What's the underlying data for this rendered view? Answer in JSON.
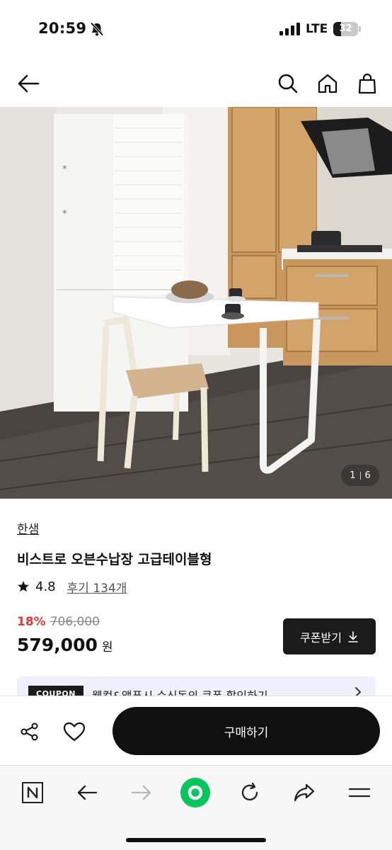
{
  "status_bar": {
    "time": "20:59",
    "network": "LTE",
    "battery_level": "32",
    "battery_fraction": 0.32,
    "icons": [
      "bell-slash-icon",
      "signal-bars-icon",
      "battery-icon"
    ]
  },
  "header": {
    "icons": [
      "back-arrow-icon",
      "search-icon",
      "home-icon",
      "shopping-bag-icon"
    ]
  },
  "gallery": {
    "current": "1",
    "total": "6"
  },
  "product": {
    "brand": "한샘",
    "title": "비스트로 오븐수납장 고급테이블형",
    "rating": "4.8",
    "review_label": "후기 134개",
    "discount": "18%",
    "original_price": "706,000",
    "price": "579,000",
    "currency": "원"
  },
  "coupon": {
    "button_label": "쿠폰받기",
    "banner_tag": "COUPON",
    "banner_text": "웰컴&앱푸시 수신동의 쿠폰 할인하기"
  },
  "action_bar": {
    "buy_label": "구매하기",
    "icons": [
      "share-icon",
      "heart-icon"
    ]
  },
  "browser_toolbar": {
    "icons": [
      "naver-n-icon",
      "back-icon",
      "forward-icon",
      "green-home-icon",
      "refresh-icon",
      "share-arrow-icon",
      "menu-icon"
    ]
  },
  "colors": {
    "discount": "#e5383b",
    "primary_button": "#111111",
    "banner_bg": "#eef1fb",
    "naver_green": "#03c75a"
  }
}
